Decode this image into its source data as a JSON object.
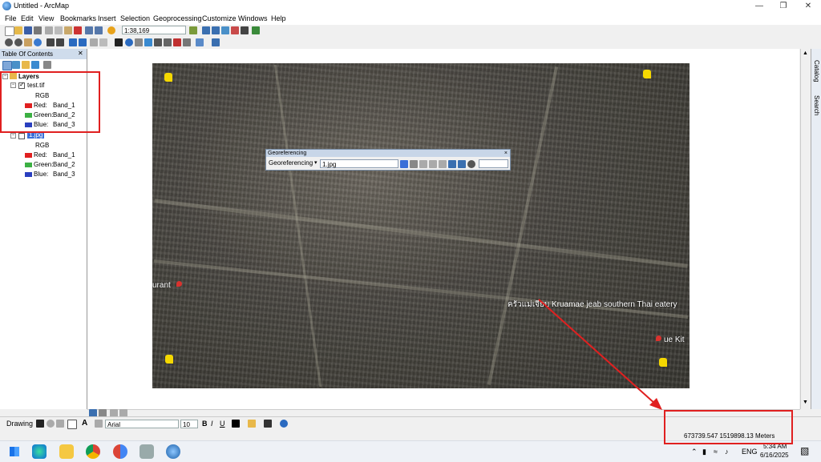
{
  "window": {
    "title": "Untitled - ArcMap",
    "minimize_icon": "minimize-icon",
    "restore_icon": "restore-icon",
    "close_icon": "close-icon"
  },
  "menu": [
    "File",
    "Edit",
    "View",
    "Bookmarks",
    "Insert",
    "Selection",
    "Geoprocessing",
    "Customize",
    "Windows",
    "Help"
  ],
  "toolbar": {
    "scale": "1:38,169"
  },
  "toc": {
    "title": "Table Of Contents",
    "root": "Layers",
    "layers": [
      {
        "name": "test.tif",
        "checked": true,
        "mode": "RGB",
        "bands": [
          {
            "label": "Red:",
            "band": "Band_1",
            "color": "#e02020"
          },
          {
            "label": "Green:",
            "band": "Band_2",
            "color": "#3cb043"
          },
          {
            "label": "Blue:",
            "band": "Band_3",
            "color": "#2a3fbf"
          }
        ]
      },
      {
        "name": "1.jpg",
        "checked": false,
        "mode": "RGB",
        "bands": [
          {
            "label": "Red:",
            "band": "Band_1",
            "color": "#e02020"
          },
          {
            "label": "Green:",
            "band": "Band_2",
            "color": "#3cb043"
          },
          {
            "label": "Blue:",
            "band": "Band_3",
            "color": "#2a3fbf"
          }
        ]
      }
    ]
  },
  "georef": {
    "title": "Georeferencing",
    "menu_label": "Georeferencing",
    "layer": "1.jpg",
    "close": "×"
  },
  "map_labels": {
    "restaurant": "ครัวแม่เจียบ Kruamae jeab southern Thai eatery",
    "left": "urant",
    "right": "ue Kit"
  },
  "side_panel": {
    "catalog": "Catalog",
    "search": "Search"
  },
  "drawing": {
    "drawing_label": "Drawing",
    "font": "Arial",
    "font_size": "10",
    "bold": "B",
    "italic": "I",
    "underline": "U",
    "text_tool": "A"
  },
  "status": {
    "coords": "673739.547  1519898.13 Meters"
  },
  "taskbar": {
    "lang": "ENG",
    "time": "5:34 AM",
    "date": "6/16/2025"
  },
  "colors": {
    "annotation": "#e02020",
    "toc_header": "#cfdcec"
  }
}
